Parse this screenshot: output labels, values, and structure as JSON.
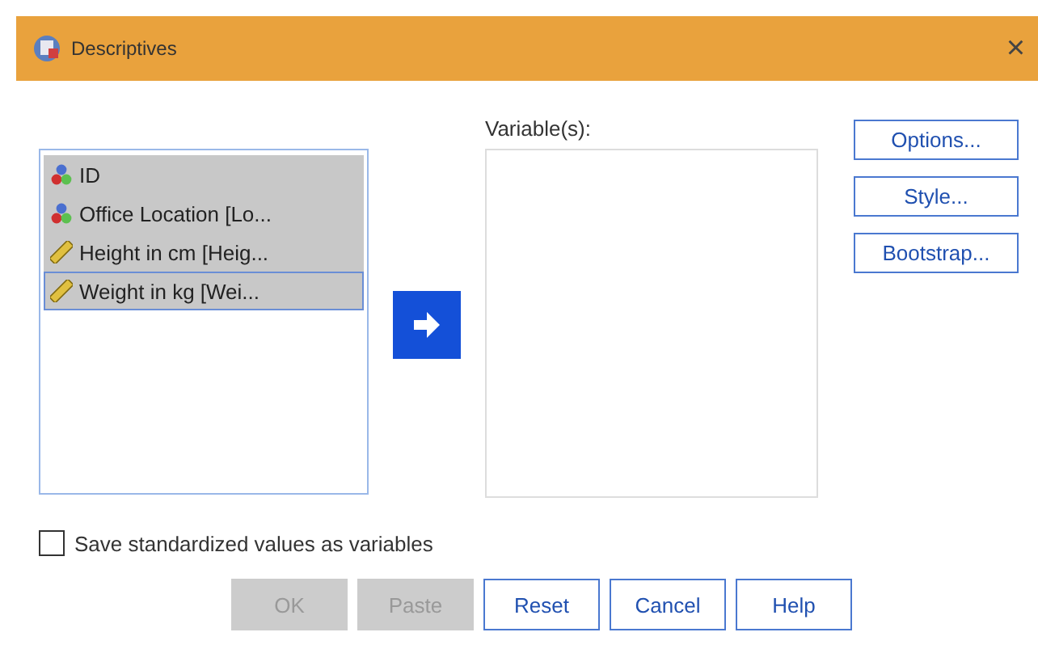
{
  "window": {
    "title": "Descriptives",
    "close": "×"
  },
  "source_list": {
    "items": [
      {
        "label": "ID",
        "kind": "nominal",
        "selected": true,
        "focused": false
      },
      {
        "label": "Office Location [Lo...",
        "kind": "nominal",
        "selected": true,
        "focused": false
      },
      {
        "label": "Height in cm [Heig...",
        "kind": "scale",
        "selected": true,
        "focused": false
      },
      {
        "label": "Weight in kg [Wei...",
        "kind": "scale",
        "selected": true,
        "focused": true
      }
    ]
  },
  "variables": {
    "label": "Variable(s):"
  },
  "side_buttons": [
    {
      "label": "Options..."
    },
    {
      "label": "Style..."
    },
    {
      "label": "Bootstrap..."
    }
  ],
  "save_option": {
    "label": "Save standardized values as variables",
    "checked": false
  },
  "buttons": [
    {
      "label": "OK",
      "disabled": true
    },
    {
      "label": "Paste",
      "disabled": true
    },
    {
      "label": "Reset",
      "disabled": false
    },
    {
      "label": "Cancel",
      "disabled": false
    },
    {
      "label": "Help",
      "disabled": false
    }
  ]
}
